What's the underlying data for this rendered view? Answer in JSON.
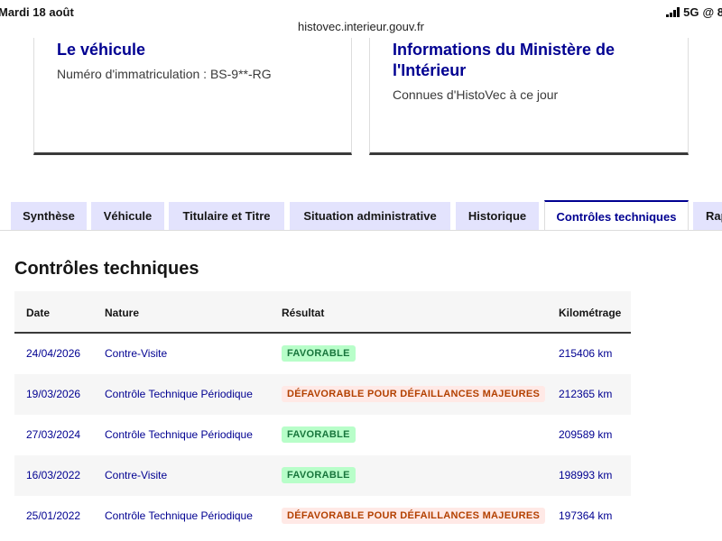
{
  "status": {
    "time": "Mardi 18 août",
    "network": "5G",
    "extra": "@ 8"
  },
  "browser": {
    "url": "histovec.interieur.gouv.fr"
  },
  "cards": [
    {
      "title": "Le véhicule",
      "description": "Numéro d'immatriculation : BS-9**-RG"
    },
    {
      "title": "Informations du Ministère de l'Intérieur",
      "description": "Connues d'HistoVec à ce jour"
    }
  ],
  "tabs": [
    {
      "label": "Synthèse"
    },
    {
      "label": "Véhicule"
    },
    {
      "label": "Titulaire et Titre"
    },
    {
      "label": "Situation administrative"
    },
    {
      "label": "Historique"
    },
    {
      "label": "Contrôles techniques",
      "active": true
    },
    {
      "label": "Rap"
    }
  ],
  "section": {
    "title": "Contrôles techniques"
  },
  "table": {
    "headers": {
      "date": "Date",
      "nature": "Nature",
      "result": "Résultat",
      "km": "Kilométrage"
    },
    "rows": [
      {
        "date": "24/04/2026",
        "nature": "Contre-Visite",
        "result": "FAVORABLE",
        "status": "ok",
        "km": "215406 km"
      },
      {
        "date": "19/03/2026",
        "nature": "Contrôle Technique Périodique",
        "result": "DÉFAVORABLE POUR DÉFAILLANCES MAJEURES",
        "status": "ko",
        "km": "212365 km"
      },
      {
        "date": "27/03/2024",
        "nature": "Contrôle Technique Périodique",
        "result": "FAVORABLE",
        "status": "ok",
        "km": "209589 km"
      },
      {
        "date": "16/03/2022",
        "nature": "Contre-Visite",
        "result": "FAVORABLE",
        "status": "ok",
        "km": "198993 km"
      },
      {
        "date": "25/01/2022",
        "nature": "Contrôle Technique Périodique",
        "result": "DÉFAVORABLE POUR DÉFAILLANCES MAJEURES",
        "status": "ko",
        "km": "197364 km"
      }
    ]
  },
  "colors": {
    "primary": "#000091",
    "tab_bg": "#e3e3fd",
    "success_bg": "#b8fec9",
    "success_text": "#18753c",
    "error_bg": "#ffe9e6",
    "error_text": "#b34000"
  }
}
